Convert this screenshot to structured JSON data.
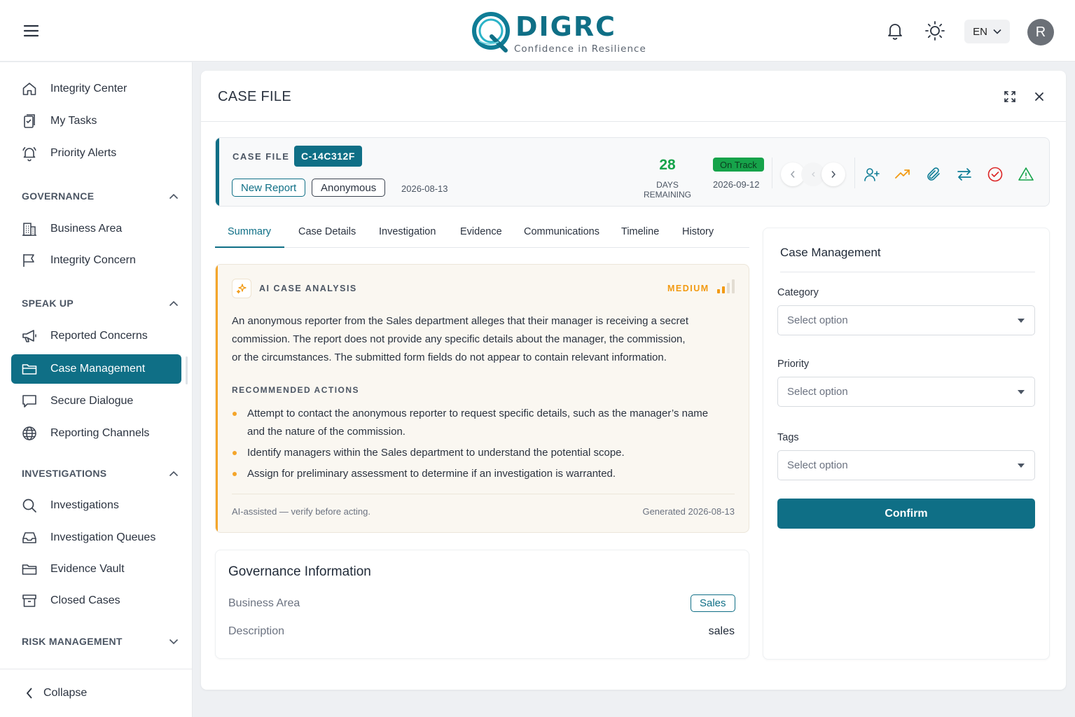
{
  "header": {
    "brand_name": "DIGRC",
    "brand_tagline": "Confidence in Resilience",
    "language": "EN",
    "avatar_initial": "R"
  },
  "sidebar": {
    "items_top": [
      {
        "label": "Integrity Center",
        "icon": "home-icon"
      },
      {
        "label": "My Tasks",
        "icon": "clipboard-icon"
      },
      {
        "label": "Priority Alerts",
        "icon": "alert-bell-icon"
      }
    ],
    "sections": [
      {
        "title": "GOVERNANCE",
        "expanded": true,
        "items": [
          {
            "label": "Business Area",
            "icon": "building-icon"
          },
          {
            "label": "Integrity Concern",
            "icon": "flag-icon"
          }
        ]
      },
      {
        "title": "SPEAK UP",
        "expanded": true,
        "items": [
          {
            "label": "Reported Concerns",
            "icon": "megaphone-icon"
          },
          {
            "label": "Case Management",
            "icon": "folder-icon",
            "active": true
          },
          {
            "label": "Secure Dialogue",
            "icon": "chat-icon"
          },
          {
            "label": "Reporting Channels",
            "icon": "globe-icon"
          }
        ]
      },
      {
        "title": "INVESTIGATIONS",
        "expanded": true,
        "items": [
          {
            "label": "Investigations",
            "icon": "search-icon"
          },
          {
            "label": "Investigation Queues",
            "icon": "inbox-icon"
          },
          {
            "label": "Evidence Vault",
            "icon": "folder-icon"
          },
          {
            "label": "Closed Cases",
            "icon": "archive-icon"
          }
        ]
      },
      {
        "title": "RISK MANAGEMENT",
        "expanded": false,
        "items": []
      }
    ],
    "collapse_label": "Collapse"
  },
  "panel": {
    "title": "CASE FILE"
  },
  "case": {
    "label": "CASE FILE",
    "id": "C-14C312F",
    "status_chip": "New Report",
    "reporter_chip": "Anonymous",
    "created_date": "2026-08-13",
    "days_remaining": "28",
    "days_remaining_label": "DAYS REMAINING",
    "track_status": "On Track",
    "due_date": "2026-09-12",
    "status_color": "#16a34a",
    "accent_color": "#0f6f86"
  },
  "tabs": [
    "Summary",
    "Case Details",
    "Investigation",
    "Evidence",
    "Communications",
    "Timeline",
    "History"
  ],
  "active_tab": "Summary",
  "ai_analysis": {
    "title": "AI CASE ANALYSIS",
    "level": "MEDIUM",
    "level_color": "#f29a12",
    "summary": "An anonymous reporter from the Sales department alleges that their manager is receiving a secret commission. The report does not provide any specific details about the manager, the commission, or the circumstances. The submitted form fields do not appear to contain relevant information.",
    "recommended_title": "RECOMMENDED ACTIONS",
    "actions": [
      "Attempt to contact the anonymous reporter to request specific details, such as the manager’s name and the nature of the commission.",
      "Identify managers within the Sales department to understand the potential scope.",
      "Assign for preliminary assessment to determine if an investigation is warranted."
    ],
    "disclaimer": "AI-assisted — verify before acting.",
    "generated": "Generated 2026-08-13"
  },
  "governance": {
    "title": "Governance Information",
    "business_area_label": "Business Area",
    "business_area_value": "Sales",
    "description_label": "Description",
    "description_value": "sales"
  },
  "case_management": {
    "title": "Case Management",
    "category_label": "Category",
    "category_placeholder": "Select option",
    "priority_label": "Priority",
    "priority_placeholder": "Select option",
    "tags_label": "Tags",
    "tags_placeholder": "Select option",
    "confirm_label": "Confirm"
  }
}
